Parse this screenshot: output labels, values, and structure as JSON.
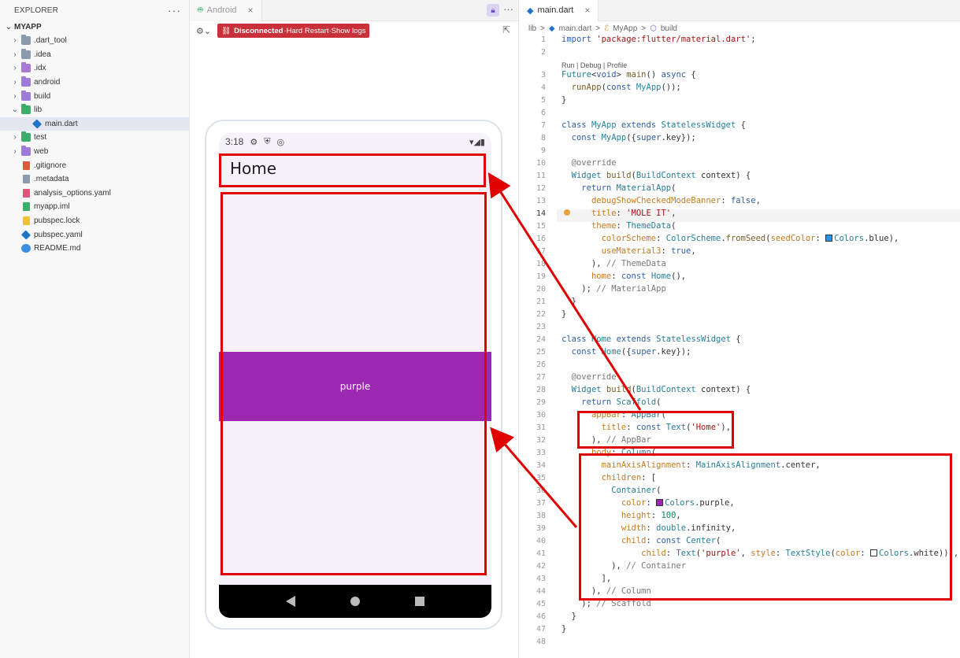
{
  "explorer": {
    "title": "EXPLORER",
    "more": "···",
    "root": "MYAPP",
    "items": [
      {
        "label": ".dart_tool",
        "type": "folder",
        "chev": "›",
        "color": "#8a9bb0",
        "depth": 1
      },
      {
        "label": ".idea",
        "type": "folder",
        "chev": "›",
        "color": "#8a9bb0",
        "depth": 1
      },
      {
        "label": ".idx",
        "type": "folder",
        "chev": "›",
        "color": "#a87ad6",
        "depth": 1
      },
      {
        "label": "android",
        "type": "folder",
        "chev": "›",
        "color": "#9c7bd9",
        "depth": 1
      },
      {
        "label": "build",
        "type": "folder",
        "chev": "›",
        "color": "#9c7bd9",
        "depth": 1
      },
      {
        "label": "lib",
        "type": "folder",
        "chev": "⌄",
        "color": "#3aae6a",
        "depth": 1
      },
      {
        "label": "main.dart",
        "type": "dart",
        "chev": "",
        "color": "#1f75c8",
        "depth": 2,
        "selected": true
      },
      {
        "label": "test",
        "type": "folder",
        "chev": "›",
        "color": "#3aae6a",
        "depth": 1
      },
      {
        "label": "web",
        "type": "folder",
        "chev": "›",
        "color": "#9c7bd9",
        "depth": 1
      },
      {
        "label": ".gitignore",
        "type": "file",
        "chev": "",
        "color": "#e0573a",
        "depth": 1
      },
      {
        "label": ".metadata",
        "type": "file",
        "chev": "",
        "color": "#8a9bb0",
        "depth": 1
      },
      {
        "label": "analysis_options.yaml",
        "type": "file",
        "chev": "",
        "color": "#e0577a",
        "depth": 1
      },
      {
        "label": "myapp.iml",
        "type": "file",
        "chev": "",
        "color": "#3aae6a",
        "depth": 1
      },
      {
        "label": "pubspec.lock",
        "type": "file",
        "chev": "",
        "color": "#f0c23c",
        "depth": 1
      },
      {
        "label": "pubspec.yaml",
        "type": "dart",
        "chev": "",
        "color": "#1f75c8",
        "depth": 1
      },
      {
        "label": "README.md",
        "type": "info",
        "chev": "",
        "color": "#3a8fe0",
        "depth": 1
      }
    ]
  },
  "android_panel": {
    "tab_label": "Android",
    "tab_close": "×",
    "status": "Disconnected",
    "separator": "·",
    "hard_restart": "Hard Restart",
    "show_logs": "Show logs",
    "phone": {
      "time": "3:18",
      "appbar_title": "Home",
      "container_text": "purple",
      "container_color": "#9c27b0"
    }
  },
  "editor": {
    "tab_label": "main.dart",
    "tab_close": "×",
    "breadcrumb": [
      "lib",
      ">",
      "main.dart",
      ">",
      "MyApp",
      ">",
      "build"
    ],
    "codelens": "Run | Debug | Profile",
    "current_line": 14
  },
  "colors": {
    "accent_red": "#e00000",
    "badge_red": "#c9313a"
  }
}
